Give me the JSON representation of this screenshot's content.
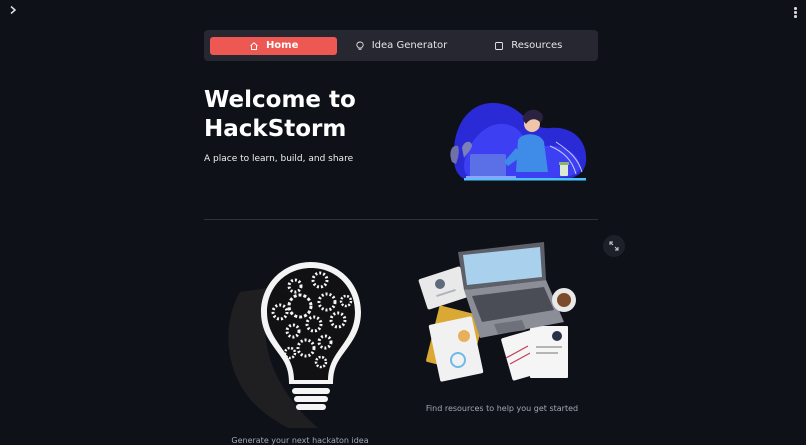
{
  "app": {
    "title_line1": "Welcome to",
    "title_line2": "HackStorm",
    "subtitle": "A place to learn, build, and share"
  },
  "nav": {
    "items": [
      {
        "label": "Home",
        "icon": "home-icon",
        "active": true
      },
      {
        "label": "Idea Generator",
        "icon": "lightbulb-icon",
        "active": false
      },
      {
        "label": "Resources",
        "icon": "square-icon",
        "active": false
      }
    ]
  },
  "images": {
    "resources_caption": "Find resources to help you get started",
    "idea_caption": "Generate your next hackaton idea"
  },
  "colors": {
    "background": "#0e1117",
    "nav_background": "#262730",
    "accent": "#ee5853"
  },
  "icons": {
    "sidebar_toggle": "chevron-right-icon",
    "main_menu": "kebab-menu-icon",
    "fullscreen": "expand-icon"
  }
}
